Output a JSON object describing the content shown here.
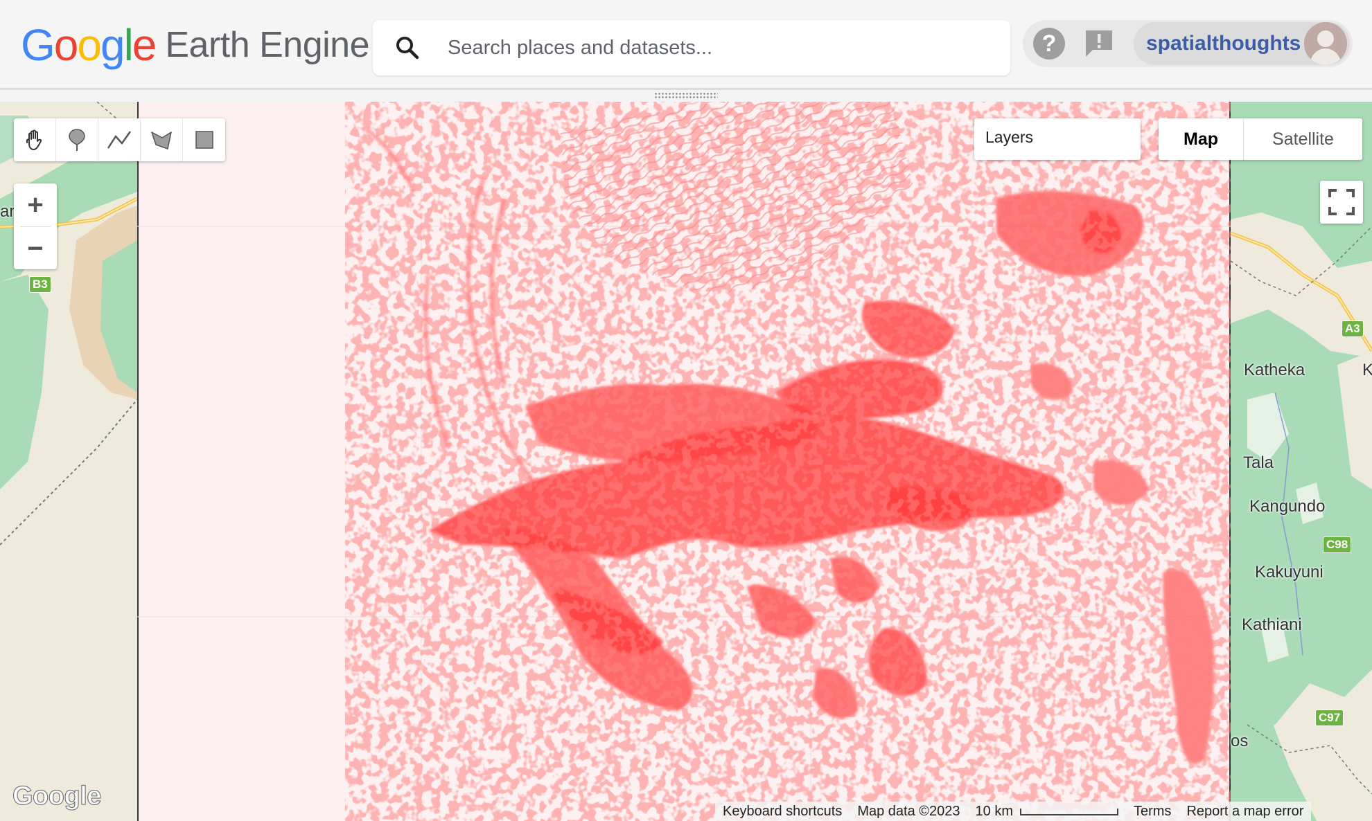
{
  "header": {
    "logo_google": "Google",
    "logo_product": "Earth Engine",
    "search": {
      "placeholder": "Search places and datasets...",
      "icon": "search-icon"
    },
    "help_label": "?",
    "username": "spatialthoughts"
  },
  "map": {
    "layers_label": "Layers",
    "map_type": {
      "options": [
        "Map",
        "Satellite"
      ],
      "selected": "Map"
    },
    "zoom": {
      "in": "+",
      "out": "−"
    },
    "draw_tools": [
      "pan-hand-icon",
      "marker-icon",
      "line-icon",
      "polygon-icon",
      "rectangle-icon"
    ],
    "place_labels": [
      "ar",
      "Katheka",
      "K",
      "Tala",
      "Kangundo",
      "Kakuyuni",
      "Kathiani",
      "os"
    ],
    "road_badges": [
      "B3",
      "A3",
      "C98",
      "C97"
    ],
    "google_mark": "Google",
    "attribution": {
      "shortcuts": "Keyboard shortcuts",
      "map_data": "Map data ©2023",
      "scale": "10 km",
      "terms": "Terms",
      "report": "Report a map error"
    },
    "overlay_color": "#ff3a3a",
    "overlay_background": "#fdf0f0"
  }
}
